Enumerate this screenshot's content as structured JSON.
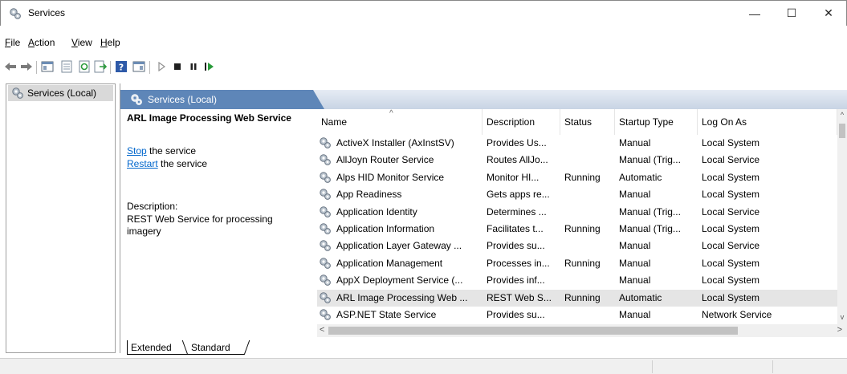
{
  "window": {
    "title": "Services",
    "minimize": "—",
    "maximize": "☐",
    "close": "✕"
  },
  "menu": [
    {
      "label": "File",
      "key": "F",
      "rest": "ile"
    },
    {
      "label": "Action",
      "key": "A",
      "rest": "ction"
    },
    {
      "label": "View",
      "key": "V",
      "rest": "iew"
    },
    {
      "label": "Help",
      "key": "H",
      "rest": "elp"
    }
  ],
  "tree": {
    "item": "Services (Local)"
  },
  "pane": {
    "header": "Services (Local)",
    "service_name": "ARL Image Processing Web Service",
    "stop_link": "Stop",
    "stop_rest": " the service",
    "restart_link": "Restart",
    "restart_rest": " the service",
    "description_label": "Description:",
    "description_text": "REST Web Service for processing imagery"
  },
  "columns": [
    "Name",
    "Description",
    "Status",
    "Startup Type",
    "Log On As"
  ],
  "sort_indicator": "^",
  "rows": [
    {
      "name": "ActiveX Installer (AxInstSV)",
      "description": "Provides Us...",
      "status": "",
      "startup": "Manual",
      "logon": "Local System",
      "selected": false
    },
    {
      "name": "AllJoyn Router Service",
      "description": "Routes AllJo...",
      "status": "",
      "startup": "Manual (Trig...",
      "logon": "Local Service",
      "selected": false
    },
    {
      "name": "Alps HID Monitor Service",
      "description": "Monitor HI...",
      "status": "Running",
      "startup": "Automatic",
      "logon": "Local System",
      "selected": false
    },
    {
      "name": "App Readiness",
      "description": "Gets apps re...",
      "status": "",
      "startup": "Manual",
      "logon": "Local System",
      "selected": false
    },
    {
      "name": "Application Identity",
      "description": "Determines ...",
      "status": "",
      "startup": "Manual (Trig...",
      "logon": "Local Service",
      "selected": false
    },
    {
      "name": "Application Information",
      "description": "Facilitates t...",
      "status": "Running",
      "startup": "Manual (Trig...",
      "logon": "Local System",
      "selected": false
    },
    {
      "name": "Application Layer Gateway ...",
      "description": "Provides su...",
      "status": "",
      "startup": "Manual",
      "logon": "Local Service",
      "selected": false
    },
    {
      "name": "Application Management",
      "description": "Processes in...",
      "status": "Running",
      "startup": "Manual",
      "logon": "Local System",
      "selected": false
    },
    {
      "name": "AppX Deployment Service (...",
      "description": "Provides inf...",
      "status": "",
      "startup": "Manual",
      "logon": "Local System",
      "selected": false
    },
    {
      "name": "ARL Image Processing Web ...",
      "description": "REST Web S...",
      "status": "Running",
      "startup": "Automatic",
      "logon": "Local System",
      "selected": true
    },
    {
      "name": "ASP.NET State Service",
      "description": "Provides su...",
      "status": "",
      "startup": "Manual",
      "logon": "Network Service",
      "selected": false
    }
  ],
  "tabs": {
    "extended": "Extended",
    "standard": "Standard"
  },
  "colors": {
    "header_blue": "#5e86b8",
    "link": "#0066cc",
    "selected_row": "#e5e5e5"
  },
  "icons": [
    "services-gear-icon",
    "back-arrow-icon",
    "forward-arrow-icon",
    "console-tree-icon",
    "properties-icon",
    "refresh-icon",
    "export-icon",
    "help-icon",
    "show-hide-icon",
    "start-icon",
    "stop-icon",
    "pause-icon",
    "resume-icon"
  ]
}
